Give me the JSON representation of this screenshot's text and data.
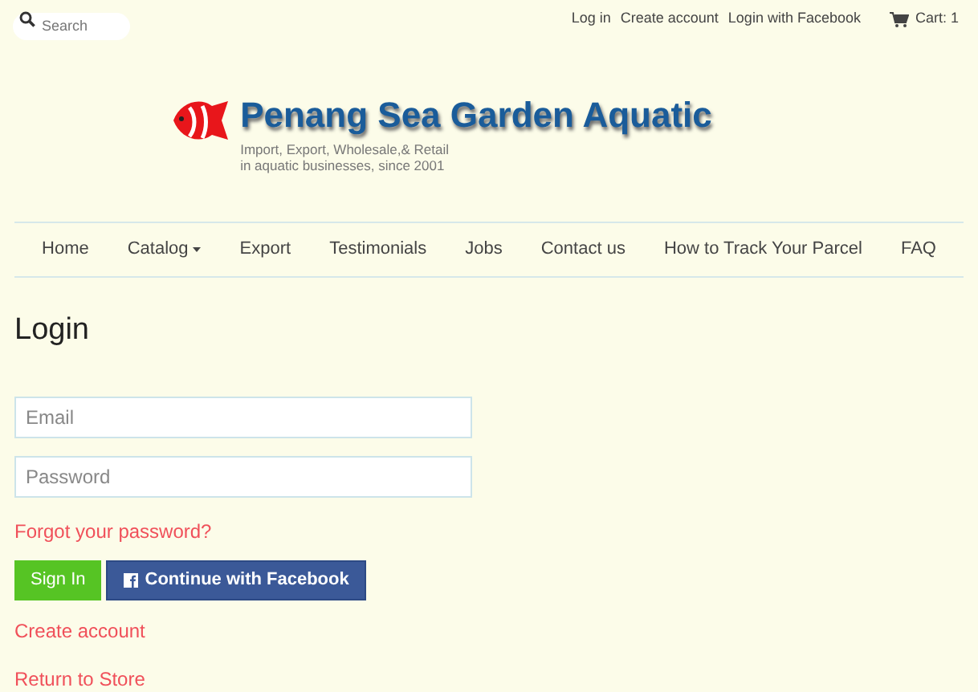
{
  "search": {
    "placeholder": "Search"
  },
  "top_links": [
    "Log in",
    "Create account",
    "Login with Facebook"
  ],
  "cart": "Cart: 1",
  "brand": {
    "title": "Penang Sea Garden Aquatic",
    "tagline": [
      "Import, Export, Wholesale,& Retail",
      "in aquatic businesses, since 2001"
    ]
  },
  "nav": [
    {
      "label": "Home",
      "kind": "link"
    },
    {
      "label": "Catalog",
      "kind": "dropdown"
    },
    {
      "label": "Export",
      "kind": "link"
    },
    {
      "label": "Testimonials",
      "kind": "link"
    },
    {
      "label": "Jobs",
      "kind": "link"
    },
    {
      "label": "Contact us",
      "kind": "link"
    },
    {
      "label": "How to Track Your Parcel",
      "kind": "link"
    },
    {
      "label": "FAQ",
      "kind": "link"
    }
  ],
  "heading": "Login",
  "fields": [
    {
      "placeholder": "Email"
    },
    {
      "placeholder": "Password"
    }
  ],
  "forgot_link": "Forgot your password?",
  "buttons": [
    {
      "label": "Sign In",
      "kind": "primary"
    },
    {
      "label": "Continue with Facebook",
      "kind": "facebook"
    }
  ],
  "links": [
    "Create account",
    "Return to Store"
  ]
}
